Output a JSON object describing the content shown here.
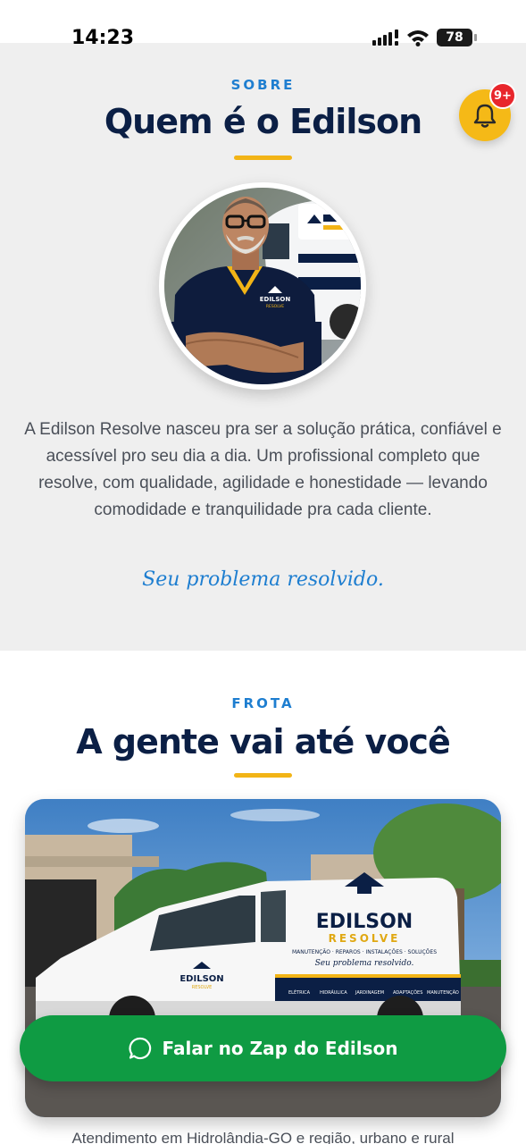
{
  "status_bar": {
    "time": "14:23",
    "battery": "78"
  },
  "notification": {
    "badge": "9+"
  },
  "about": {
    "eyebrow": "SOBRE",
    "title": "Quem é o Edilson",
    "description": "A Edilson Resolve nasceu pra ser a solução prática, confiável e acessível pro seu dia a dia. Um profissional completo que resolve, com qualidade, agilidade e honestidade — levando comodidade e tranquilidade pra cada cliente.",
    "tagline": "Seu problema resolvido."
  },
  "fleet": {
    "eyebrow": "FROTA",
    "title": "A gente vai até você",
    "caption": "Atendimento em Hidrolândia-GO e região, urbano e rural"
  },
  "branding": {
    "shirt_logo_top": "EDILSON",
    "shirt_logo_bottom": "RESOLVE",
    "van_logo_top": "EDILSON",
    "van_logo_bottom": "RESOLVE",
    "van_services_line": "MANUTENÇÃO · REPAROS · INSTALAÇÕES · SOLUÇÕES",
    "van_tagline": "Seu problema resolvido.",
    "van_service_tags": [
      "ELÉTRICA",
      "HIDRÁULICA",
      "JARDINAGEM",
      "ADAPTAÇÕES",
      "MANUTENÇÃO"
    ]
  },
  "cta": {
    "label": "Falar no Zap do Edilson"
  },
  "colors": {
    "accent_blue": "#1e7ed0",
    "navy": "#0b1f45",
    "yellow": "#f2b416",
    "whatsapp_green": "#0f9b43",
    "badge_red": "#e8262c"
  }
}
